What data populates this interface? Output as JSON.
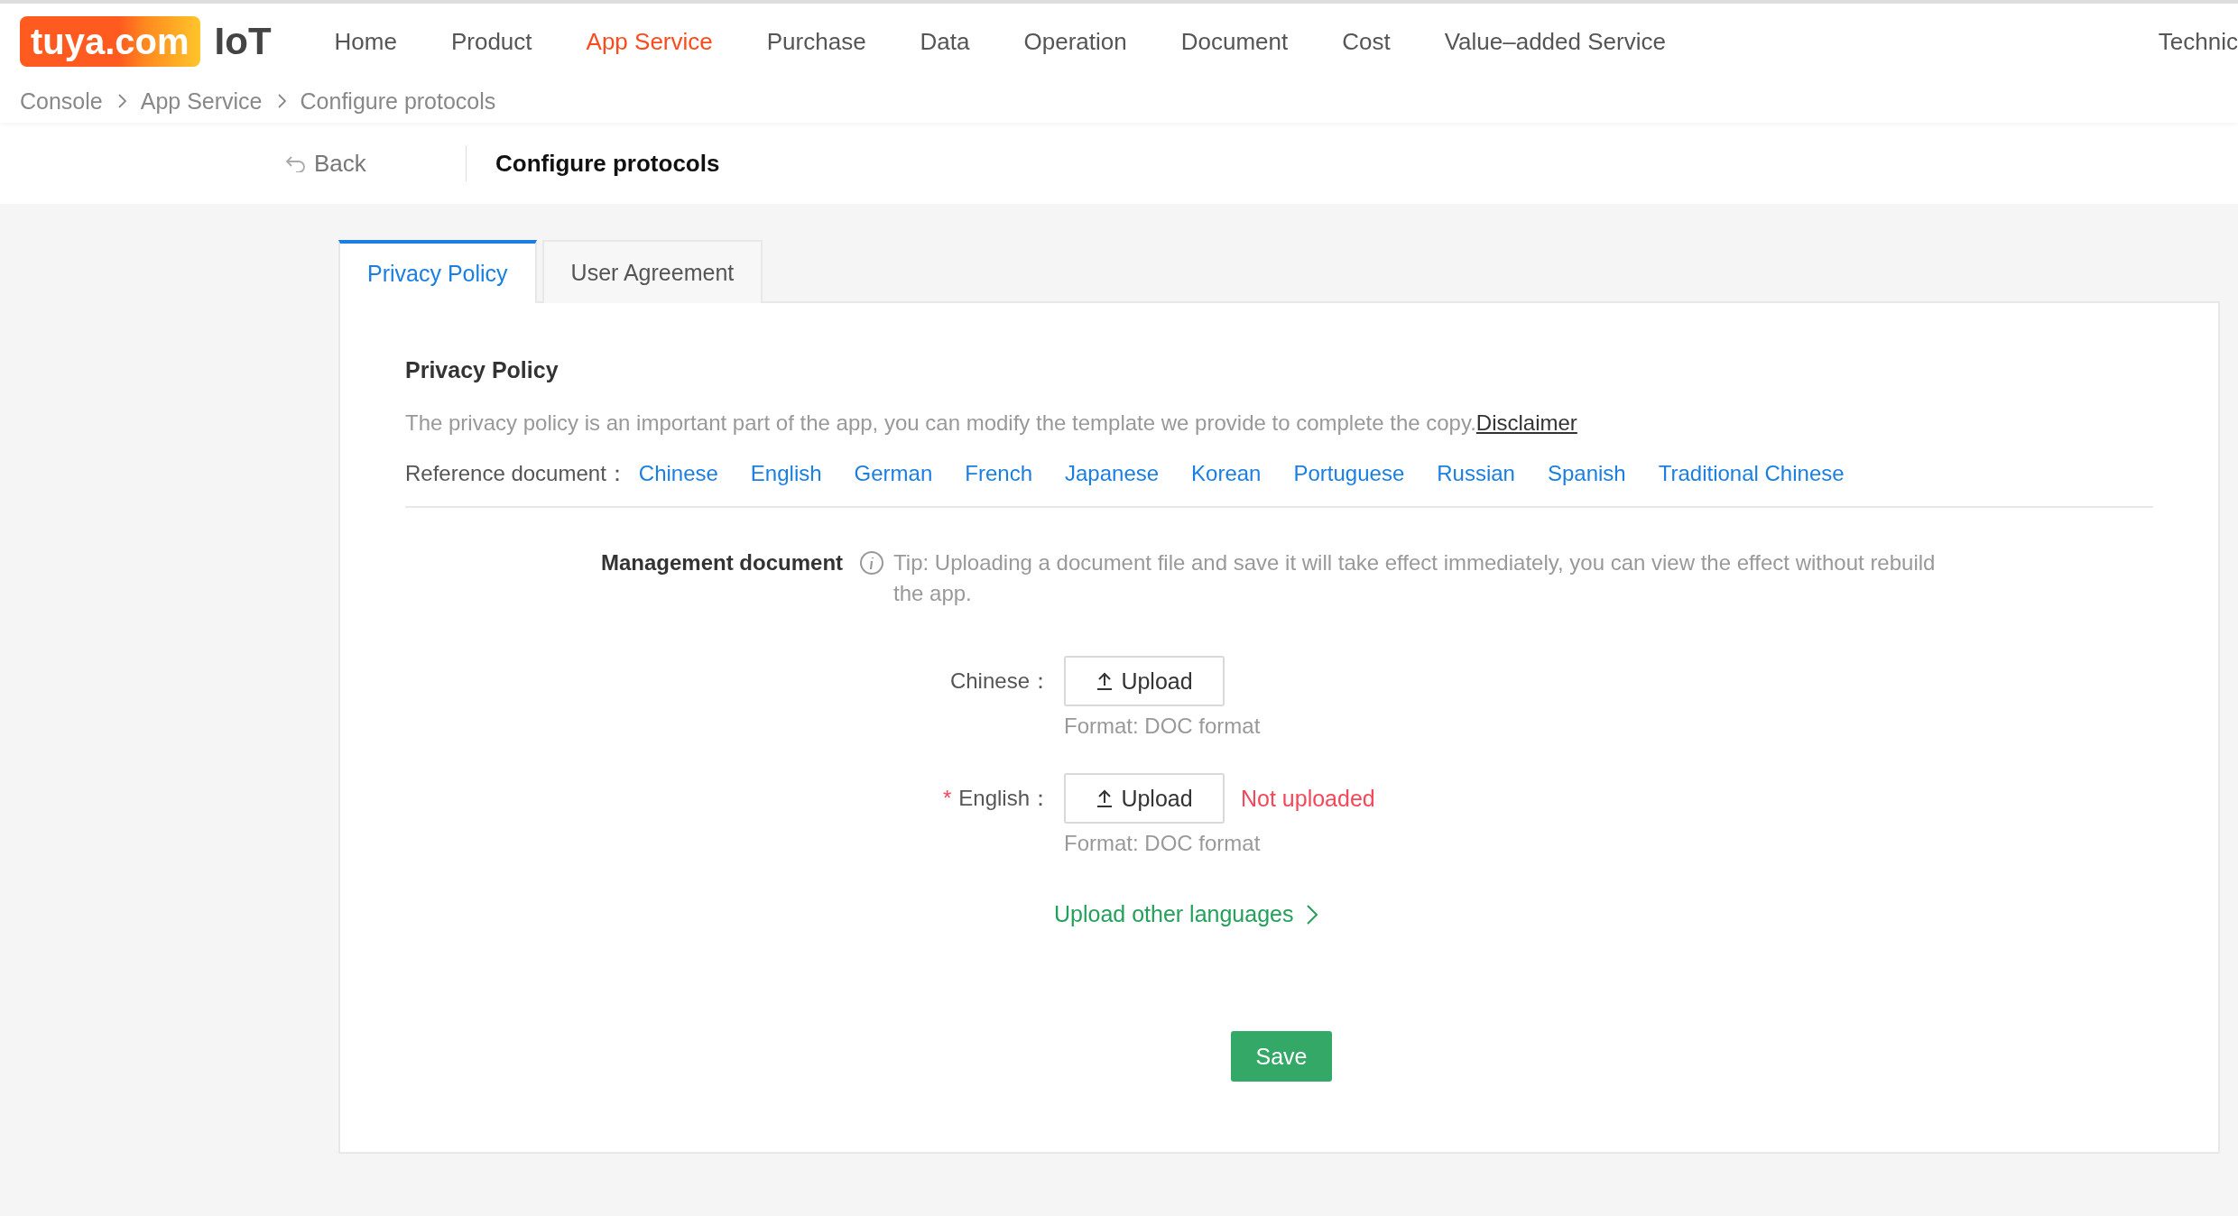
{
  "logo": {
    "brand": "tuya.com",
    "product": "IoT"
  },
  "nav": [
    {
      "label": "Home",
      "selected": false
    },
    {
      "label": "Product",
      "selected": false
    },
    {
      "label": "App Service",
      "selected": true
    },
    {
      "label": "Purchase",
      "selected": false
    },
    {
      "label": "Data",
      "selected": false
    },
    {
      "label": "Operation",
      "selected": false
    },
    {
      "label": "Document",
      "selected": false
    },
    {
      "label": "Cost",
      "selected": false
    },
    {
      "label": "Value–added Service",
      "selected": false
    },
    {
      "label": "Technic",
      "selected": false
    }
  ],
  "breadcrumb": [
    "Console",
    "App Service",
    "Configure protocols"
  ],
  "back": "Back",
  "page_title": "Configure protocols",
  "tabs": [
    {
      "label": "Privacy Policy",
      "selected": true
    },
    {
      "label": "User Agreement",
      "selected": false
    }
  ],
  "section": {
    "title": "Privacy Policy",
    "description": "The privacy policy is an important part of the app, you can modify the template we provide to complete the copy.",
    "disclaimer": "Disclaimer",
    "reference_label": "Reference document：",
    "references": [
      "Chinese",
      "English",
      "German",
      "French",
      "Japanese",
      "Korean",
      "Portuguese",
      "Russian",
      "Spanish",
      "Traditional Chinese"
    ]
  },
  "management": {
    "label": "Management document",
    "tip": "Tip: Uploading a document file and save it will take effect immediately, you can view the effect without rebuild the app."
  },
  "uploads": [
    {
      "label": "Chinese：",
      "button": "Upload",
      "hint": "Format: DOC format"
    },
    {
      "required_mark": "*",
      "label": "English：",
      "button": "Upload",
      "status": "Not uploaded",
      "hint": "Format: DOC format"
    }
  ],
  "other_languages": "Upload other languages",
  "save": "Save"
}
